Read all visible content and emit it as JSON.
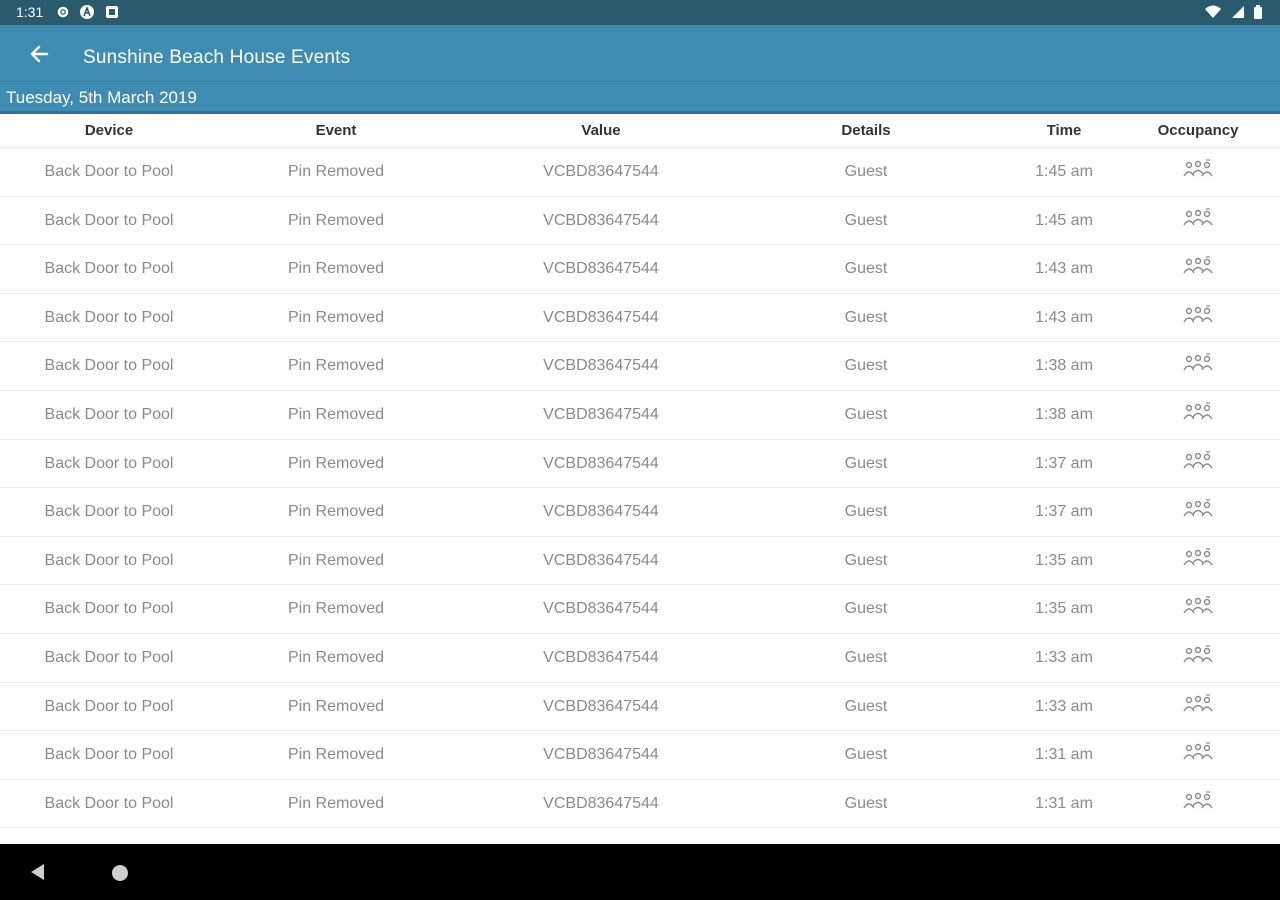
{
  "status_bar": {
    "time": "1:31",
    "left_icons": [
      "settings-icon",
      "a-badge-icon",
      "notification-square-icon"
    ],
    "right_icons": [
      "wifi-icon",
      "signal-icon",
      "battery-icon"
    ]
  },
  "app_bar": {
    "title": "Sunshine Beach House Events",
    "back_icon": "arrow-left-icon"
  },
  "date_bar": {
    "date": "Tuesday, 5th March 2019"
  },
  "table": {
    "columns": [
      "Device",
      "Event",
      "Value",
      "Details",
      "Time",
      "Occupancy"
    ],
    "rows": [
      {
        "device": "Back Door to Pool",
        "event": "Pin Removed",
        "value": "VCBD83647544",
        "details": "Guest",
        "time": "1:45 am",
        "occupancy_icon": "people-occupied-icon"
      },
      {
        "device": "Back Door to Pool",
        "event": "Pin Removed",
        "value": "VCBD83647544",
        "details": "Guest",
        "time": "1:45 am",
        "occupancy_icon": "people-occupied-icon"
      },
      {
        "device": "Back Door to Pool",
        "event": "Pin Removed",
        "value": "VCBD83647544",
        "details": "Guest",
        "time": "1:43 am",
        "occupancy_icon": "people-occupied-icon"
      },
      {
        "device": "Back Door to Pool",
        "event": "Pin Removed",
        "value": "VCBD83647544",
        "details": "Guest",
        "time": "1:43 am",
        "occupancy_icon": "people-occupied-icon"
      },
      {
        "device": "Back Door to Pool",
        "event": "Pin Removed",
        "value": "VCBD83647544",
        "details": "Guest",
        "time": "1:38 am",
        "occupancy_icon": "people-occupied-icon"
      },
      {
        "device": "Back Door to Pool",
        "event": "Pin Removed",
        "value": "VCBD83647544",
        "details": "Guest",
        "time": "1:38 am",
        "occupancy_icon": "people-occupied-icon"
      },
      {
        "device": "Back Door to Pool",
        "event": "Pin Removed",
        "value": "VCBD83647544",
        "details": "Guest",
        "time": "1:37 am",
        "occupancy_icon": "people-occupied-icon"
      },
      {
        "device": "Back Door to Pool",
        "event": "Pin Removed",
        "value": "VCBD83647544",
        "details": "Guest",
        "time": "1:37 am",
        "occupancy_icon": "people-occupied-icon"
      },
      {
        "device": "Back Door to Pool",
        "event": "Pin Removed",
        "value": "VCBD83647544",
        "details": "Guest",
        "time": "1:35 am",
        "occupancy_icon": "people-occupied-icon"
      },
      {
        "device": "Back Door to Pool",
        "event": "Pin Removed",
        "value": "VCBD83647544",
        "details": "Guest",
        "time": "1:35 am",
        "occupancy_icon": "people-occupied-icon"
      },
      {
        "device": "Back Door to Pool",
        "event": "Pin Removed",
        "value": "VCBD83647544",
        "details": "Guest",
        "time": "1:33 am",
        "occupancy_icon": "people-occupied-icon"
      },
      {
        "device": "Back Door to Pool",
        "event": "Pin Removed",
        "value": "VCBD83647544",
        "details": "Guest",
        "time": "1:33 am",
        "occupancy_icon": "people-occupied-icon"
      },
      {
        "device": "Back Door to Pool",
        "event": "Pin Removed",
        "value": "VCBD83647544",
        "details": "Guest",
        "time": "1:31 am",
        "occupancy_icon": "people-occupied-icon"
      },
      {
        "device": "Back Door to Pool",
        "event": "Pin Removed",
        "value": "VCBD83647544",
        "details": "Guest",
        "time": "1:31 am",
        "occupancy_icon": "people-occupied-icon"
      }
    ]
  },
  "nav_bar": {
    "icons": [
      "nav-back-icon",
      "nav-home-icon"
    ]
  },
  "colors": {
    "status_bar": "#2a5a6e",
    "app_bar": "#3f8cb3",
    "text_muted": "#8a8a8a"
  }
}
